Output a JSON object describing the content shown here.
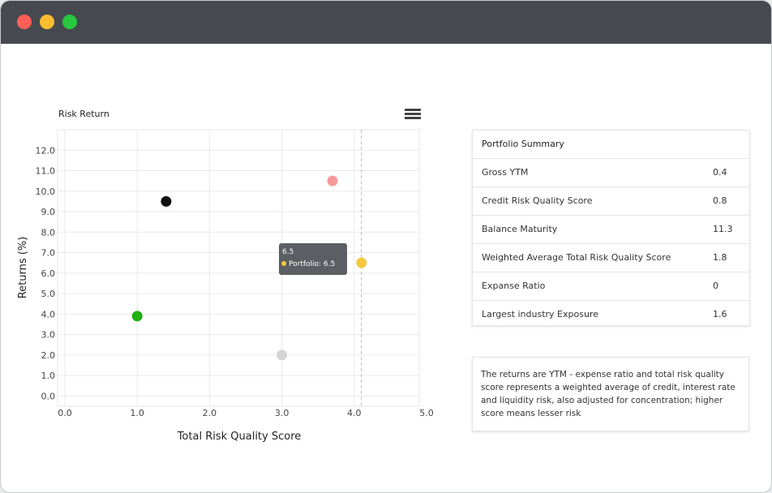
{
  "window": {
    "controls": [
      "close",
      "minimize",
      "maximize"
    ]
  },
  "chart_title": "Risk Return",
  "chart_data": {
    "type": "scatter",
    "title": "Risk Return",
    "xlabel": "Total Risk Quality Score",
    "ylabel": "Returns (%)",
    "xlim": [
      0,
      5
    ],
    "ylim": [
      -0.5,
      13
    ],
    "x_ticks": [
      "0.0",
      "1.0",
      "2.0",
      "3.0",
      "4.0",
      "5.0"
    ],
    "y_ticks": [
      "0.0",
      "1.0",
      "2.0",
      "3.0",
      "4.0",
      "5.0",
      "6.0",
      "7.0",
      "8.0",
      "9.0",
      "10.0",
      "11.0",
      "12.0"
    ],
    "grid": true,
    "crosshair_x": 4.1,
    "points": [
      {
        "x": 1.4,
        "y": 9.5,
        "color": "#111111"
      },
      {
        "x": 3.7,
        "y": 10.5,
        "color": "#f59a9a"
      },
      {
        "x": 4.1,
        "y": 6.5,
        "color": "#f5c842",
        "name": "Portfolio"
      },
      {
        "x": 1.0,
        "y": 3.9,
        "color": "#22b014"
      },
      {
        "x": 3.0,
        "y": 2.0,
        "color": "#d4d4d4"
      }
    ]
  },
  "tooltip": {
    "title": "6.5",
    "label": "Portfolio: 6.5"
  },
  "summary": {
    "heading": "Portfolio Summary",
    "rows": [
      {
        "label": "Gross YTM",
        "value": "0.4"
      },
      {
        "label": "Credit Risk Quality Score",
        "value": "0.8"
      },
      {
        "label": "Balance Maturity",
        "value": "11.3"
      },
      {
        "label": "Weighted Average Total Risk Quality Score",
        "value": "1.8"
      },
      {
        "label": "Expanse Ratio",
        "value": "0"
      },
      {
        "label": "Largest industry Exposure",
        "value": "1.6"
      }
    ]
  },
  "note": "The returns are YTM - expense ratio and total risk quality score represents a weighted average of credit, interest  rate and liquidity risk, also adjusted for concentration; higher score means lesser risk",
  "icons": {
    "menu": "hamburger-list-icon"
  }
}
